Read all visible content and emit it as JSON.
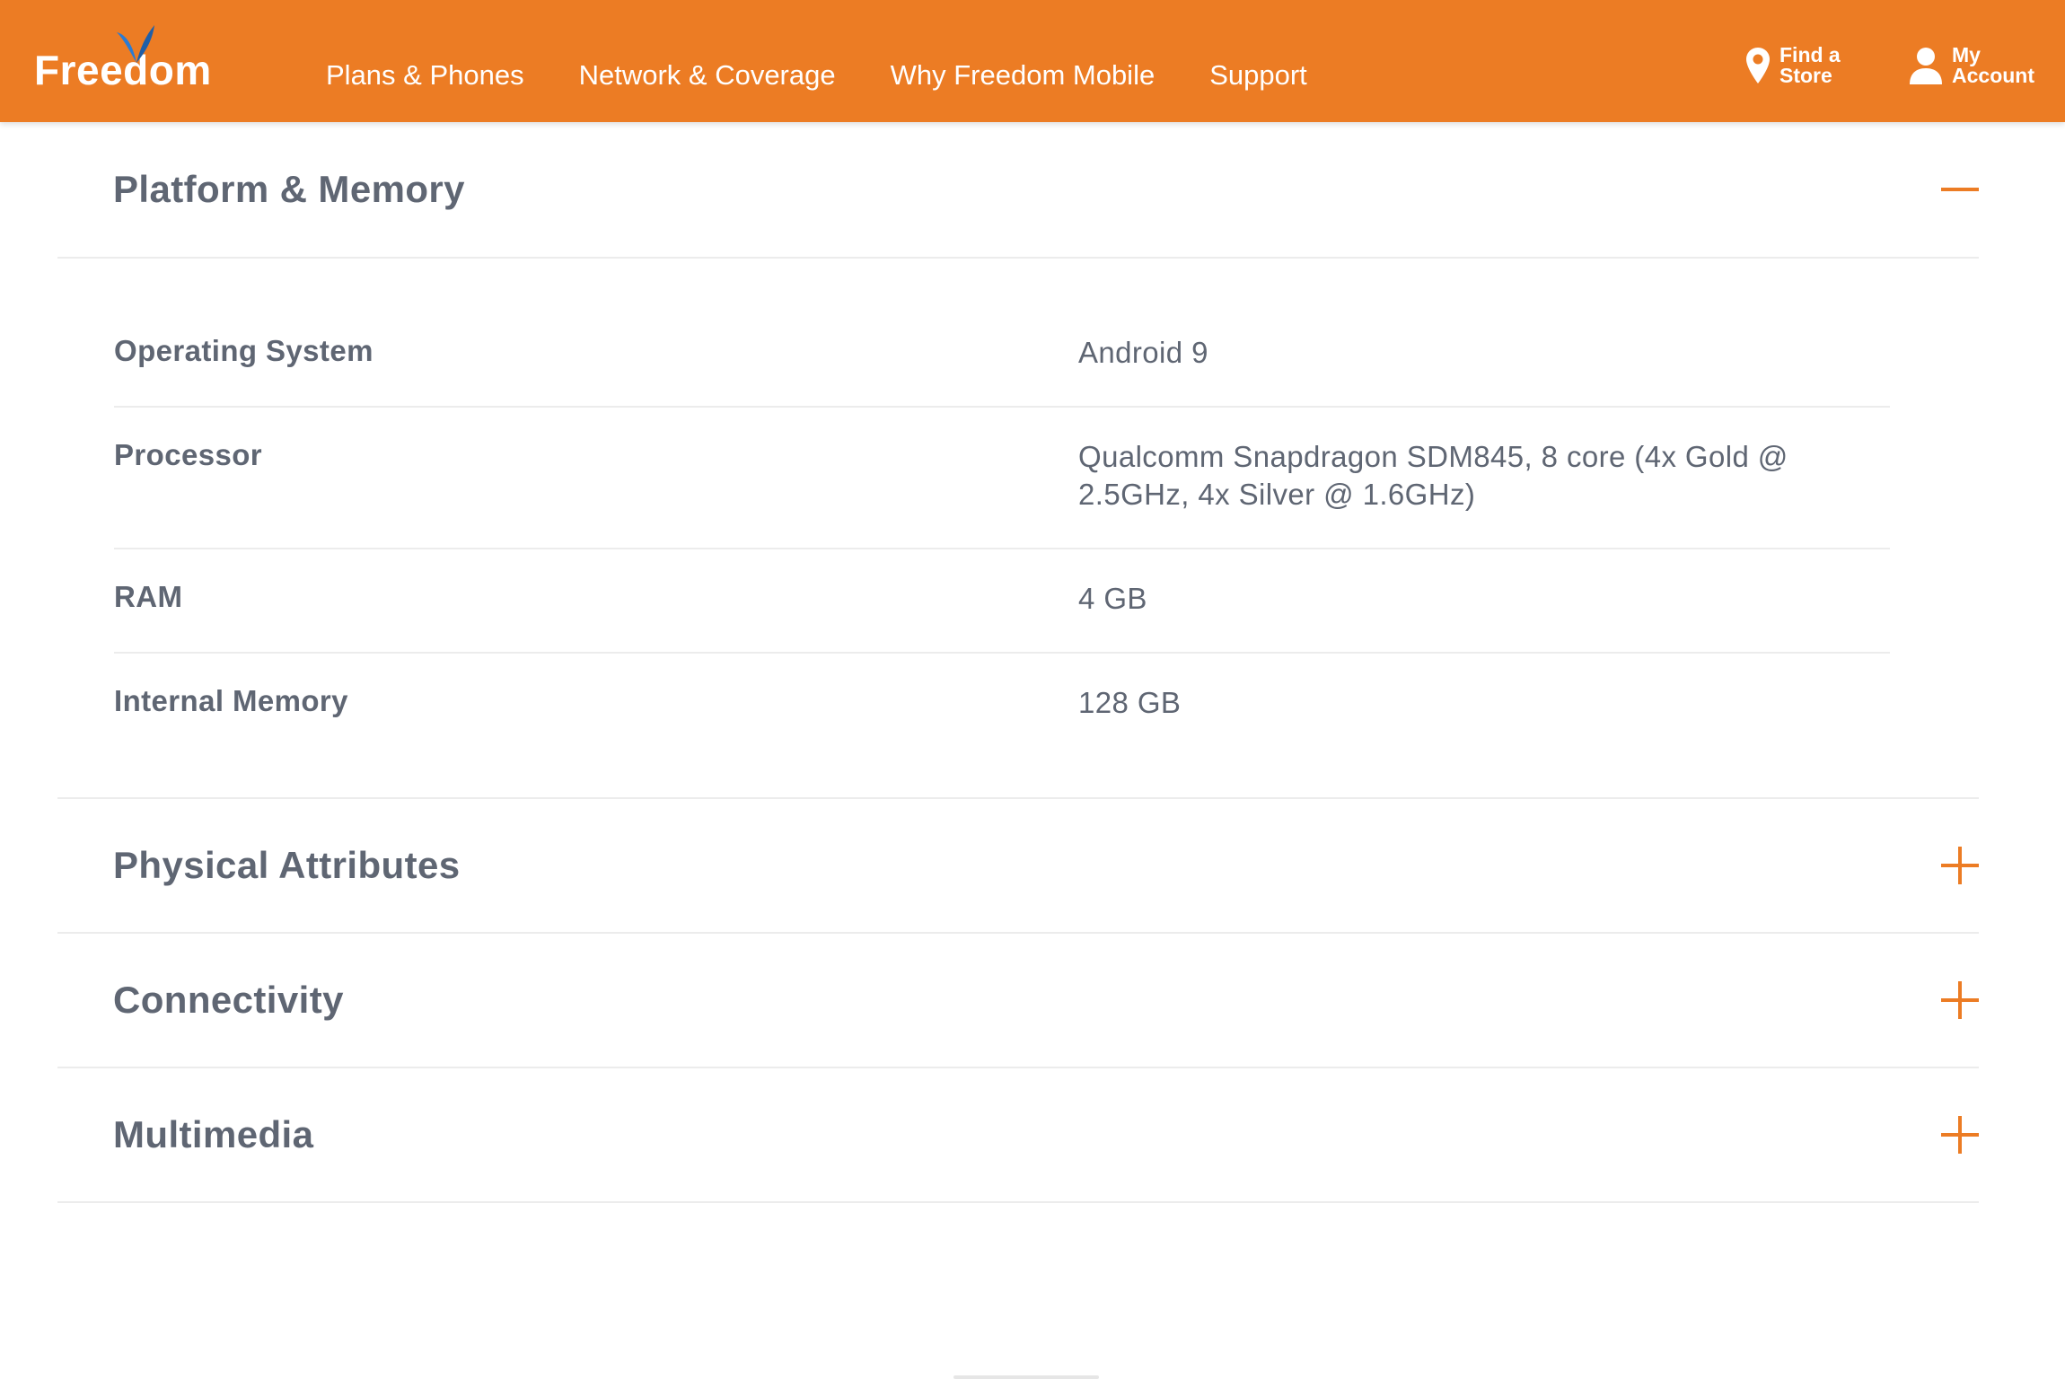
{
  "header": {
    "logo_text": "Freedom",
    "nav": [
      {
        "label": "Plans & Phones"
      },
      {
        "label": "Network & Coverage"
      },
      {
        "label": "Why Freedom Mobile"
      },
      {
        "label": "Support"
      }
    ],
    "find_store": {
      "line1": "Find a",
      "line2": "Store",
      "icon": "map-pin-icon"
    },
    "account": {
      "line1": "My",
      "line2": "Account",
      "icon": "user-icon"
    },
    "colors": {
      "brand_orange": "#ec7c24",
      "logo_blue": "#2b7bd3"
    }
  },
  "sections": [
    {
      "title": "Platform & Memory",
      "state": "expanded",
      "toggle_icon": "minus-icon",
      "specs": [
        {
          "label": "Operating System",
          "value": "Android 9"
        },
        {
          "label": "Processor",
          "value": "Qualcomm Snapdragon SDM845, 8 core (4x Gold @ 2.5GHz, 4x Silver @ 1.6GHz)"
        },
        {
          "label": "RAM",
          "value": "4 GB"
        },
        {
          "label": "Internal Memory",
          "value": "128 GB"
        }
      ]
    },
    {
      "title": "Physical Attributes",
      "state": "collapsed",
      "toggle_icon": "plus-icon"
    },
    {
      "title": "Connectivity",
      "state": "collapsed",
      "toggle_icon": "plus-icon"
    },
    {
      "title": "Multimedia",
      "state": "collapsed",
      "toggle_icon": "plus-icon"
    }
  ],
  "colors": {
    "text": "#5f6673",
    "divider": "#ececec",
    "accent": "#ec7c24"
  }
}
